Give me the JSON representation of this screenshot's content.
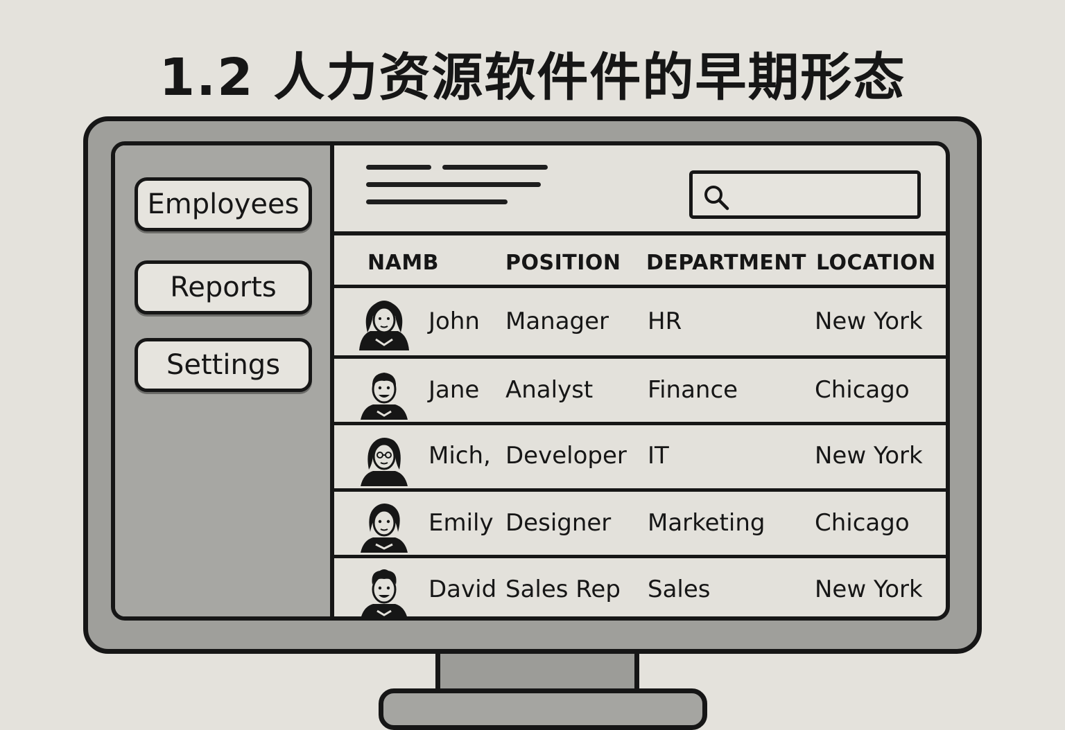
{
  "page": {
    "title": "1.2  人力资源软件件的早期形态"
  },
  "sidebar": {
    "items": [
      {
        "label": "Employees"
      },
      {
        "label": "Reports"
      },
      {
        "label": "Settings"
      }
    ]
  },
  "search": {
    "value": "",
    "icon": "search-icon"
  },
  "table": {
    "headers": [
      "NAMB",
      "POSITION",
      "DEPARTMENT",
      "LOCATION"
    ],
    "rows": [
      {
        "name": "John",
        "position": "Manager",
        "department": "HR",
        "location": "New York",
        "avatar": "avatar-long-hair-icon"
      },
      {
        "name": "Jane",
        "position": "Analyst",
        "department": "Finance",
        "location": "Chicago",
        "avatar": "avatar-short-hair-icon"
      },
      {
        "name": "Mich,",
        "position": "Developer",
        "department": "IT",
        "location": "New York",
        "avatar": "avatar-glasses-icon"
      },
      {
        "name": "Emily",
        "position": "Designer",
        "department": "Marketing",
        "location": "Chicago",
        "avatar": "avatar-bob-hair-icon"
      },
      {
        "name": "David",
        "position": "Sales Rep",
        "department": "Sales",
        "location": "New York",
        "avatar": "avatar-curly-hair-icon"
      }
    ]
  },
  "colors": {
    "ink": "#161616",
    "screen": "#e3e1db",
    "sidebar": "#a7a7a3",
    "bezel": "#9f9f9b",
    "background": "#e4e2dc"
  }
}
